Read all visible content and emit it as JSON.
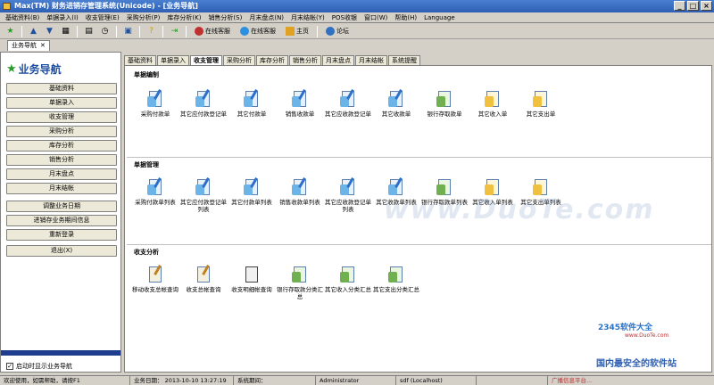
{
  "window": {
    "title": "Max(TM) 财务进销存管理系统(Unicode) - [业务导航]"
  },
  "menu": [
    "基础资料(B)",
    "单据录入(I)",
    "收支管理(E)",
    "采购分析(P)",
    "库存分析(K)",
    "销售分析(S)",
    "月末盘点(N)",
    "月末结帐(Y)",
    "POS收银",
    "窗口(W)",
    "帮助(H)",
    "Language"
  ],
  "toolbar": {
    "online1": "在线客服",
    "online2": "在线客服",
    "home": "主页",
    "forum": "论坛"
  },
  "doc_tab": {
    "label": "业务导航",
    "close": "✕"
  },
  "sidebar": {
    "title": "业务导航",
    "items": [
      "基础资料",
      "单据录入",
      "收支管理",
      "采购分析",
      "库存分析",
      "销售分析",
      "月末盘点",
      "月末结帐"
    ],
    "actions": [
      "调整业务日期",
      "进销存业务期间信息",
      "重新登录",
      "退出(X)"
    ],
    "checkbox_label": "启动时显示业务导航"
  },
  "tabs": [
    "基础资料",
    "单据录入",
    "收支管理",
    "采购分析",
    "库存分析",
    "销售分析",
    "月末盘点",
    "月末结帐",
    "系统提醒"
  ],
  "sections": [
    {
      "title": "单据编制",
      "items": [
        "采购付款单",
        "其它应付款登记单",
        "其它付款单",
        "销售收款单",
        "其它应收款登记单",
        "其它收款单",
        "银行存取款单",
        "其它收入单",
        "其它支出单"
      ]
    },
    {
      "title": "单据管理",
      "items": [
        "采购付款单列表",
        "其它应付款登记单列表",
        "其它付款单列表",
        "销售收款单列表",
        "其它应收款登记单列表",
        "其它收款单列表",
        "银行存取款单列表",
        "其它收入单列表",
        "其它支出单列表"
      ]
    },
    {
      "title": "收支分析",
      "items": [
        "移动收支总帐查询",
        "收支总帐查询",
        "收支明细帐查询",
        "银行存取款分类汇总",
        "其它收入分类汇总",
        "其它支出分类汇总"
      ]
    }
  ],
  "watermark": "www.DuoTe.com",
  "branding": {
    "logo": "2345软件大全",
    "url": "www.DuoTe.com",
    "site": "国内最安全的软件站"
  },
  "status": {
    "help": "欢迎使用，如需帮助，请按F1",
    "biz_date": "业务日期： 2013-10-10 13:27:19",
    "period": "系统期间：",
    "user": "Administrator",
    "db": "sdf (Localhost)",
    "ad": "广播信息平台..."
  },
  "colors": {
    "title_bar": "#2e5fb4",
    "sidebar_title": "#1f4f9f",
    "accent": "#6cb4e8"
  }
}
